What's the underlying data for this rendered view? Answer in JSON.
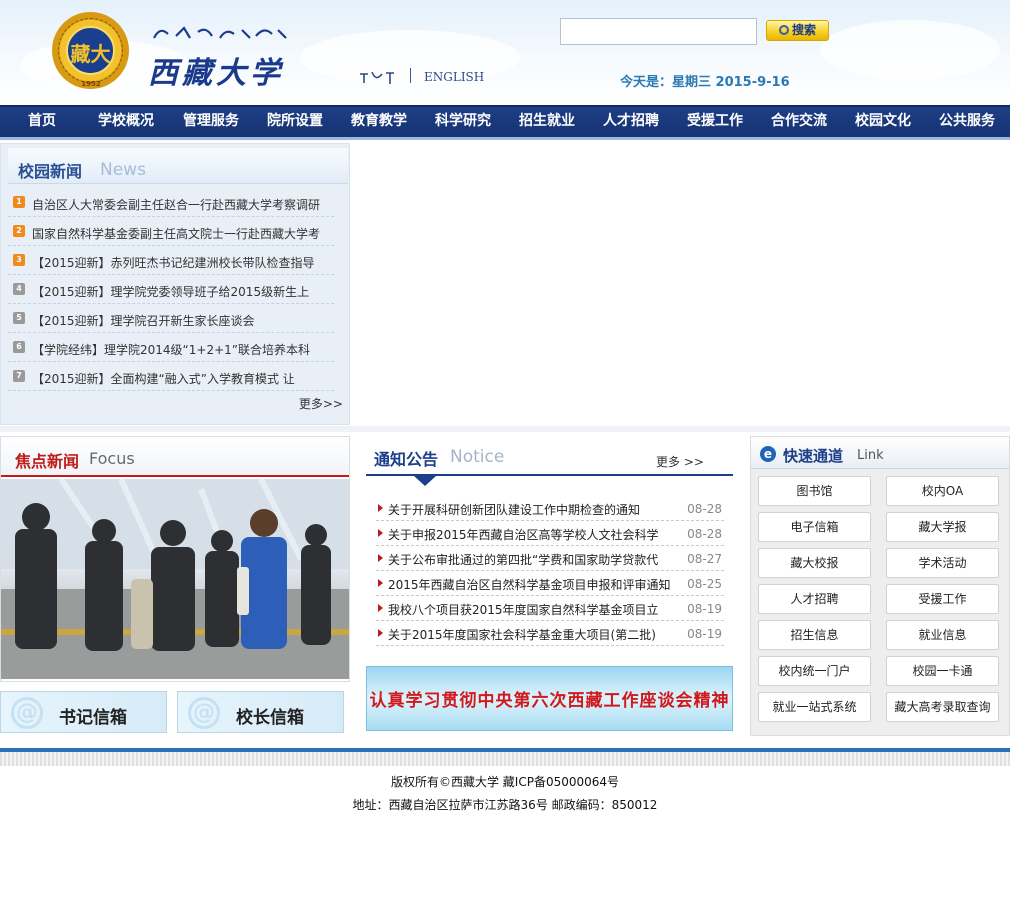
{
  "header": {
    "school_name": "西藏大学",
    "seal_char": "藏大",
    "seal_year": "1952",
    "lang_english": "ENGLISH",
    "search_button": "搜索",
    "today": "今天是：星期三  2015-9-16"
  },
  "nav": [
    "首页",
    "学校概况",
    "管理服务",
    "院所设置",
    "教育教学",
    "科学研究",
    "招生就业",
    "人才招聘",
    "受援工作",
    "合作交流",
    "校园文化",
    "公共服务"
  ],
  "campus_news": {
    "title": "校园新闻",
    "title_en": "News",
    "items": [
      {
        "num": "1",
        "text": "自治区人大常委会副主任赵合一行赴西藏大学考察调研"
      },
      {
        "num": "2",
        "text": "国家自然科学基金委副主任高文院士一行赴西藏大学考"
      },
      {
        "num": "3",
        "text": "【2015迎新】赤列旺杰书记纪建洲校长带队检查指导"
      },
      {
        "num": "4",
        "text": "【2015迎新】理学院党委领导班子给2015级新生上"
      },
      {
        "num": "5",
        "text": "【2015迎新】理学院召开新生家长座谈会"
      },
      {
        "num": "6",
        "text": "【学院经纬】理学院2014级“1+2+1”联合培养本科"
      },
      {
        "num": "7",
        "text": "【2015迎新】全面构建“融入式”入学教育模式 让"
      }
    ],
    "more": "更多>>"
  },
  "focus": {
    "title": "焦点新闻",
    "title_en": "Focus"
  },
  "mailboxes": [
    "书记信箱",
    "校长信箱"
  ],
  "notice": {
    "title": "通知公告",
    "title_en": "Notice",
    "more": "更多 >>",
    "items": [
      {
        "text": "关于开展科研创新团队建设工作中期检查的通知",
        "date": "08-28"
      },
      {
        "text": "关于申报2015年西藏自治区高等学校人文社会科学",
        "date": "08-28"
      },
      {
        "text": "关于公布审批通过的第四批“学费和国家助学贷款代",
        "date": "08-27"
      },
      {
        "text": "2015年西藏自治区自然科学基金项目申报和评审通知",
        "date": "08-25"
      },
      {
        "text": "我校八个项目获2015年度国家自然科学基金项目立",
        "date": "08-19"
      },
      {
        "text": "关于2015年度国家社会科学基金重大项目(第二批)",
        "date": "08-19"
      }
    ]
  },
  "slogan": "认真学习贯彻中央第六次西藏工作座谈会精神",
  "quick_links": {
    "title": "快速通道",
    "title_en": "Link",
    "items": [
      "图书馆",
      "校内OA",
      "电子信箱",
      "藏大学报",
      "藏大校报",
      "学术活动",
      "人才招聘",
      "受援工作",
      "招生信息",
      "就业信息",
      "校内统一门户",
      "校园一卡通",
      "就业一站式系统",
      "藏大高考录取查询"
    ]
  },
  "footer": {
    "copyright": "版权所有©西藏大学 藏ICP备05000064号",
    "address": "地址：西藏自治区拉萨市江苏路36号 邮政编码：850012"
  },
  "colors": {
    "nav_bg": "#1b3a7e",
    "accent_red": "#c11a1a",
    "accent_blue": "#1d3f8a",
    "news_num_colors": [
      "#f08a1c",
      "#f08a1c",
      "#f08a1c",
      "#9a9a9a",
      "#9a9a9a",
      "#9a9a9a",
      "#9a9a9a"
    ]
  }
}
